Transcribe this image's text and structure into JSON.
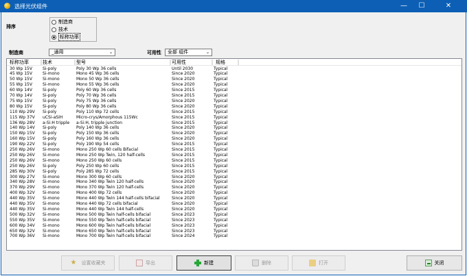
{
  "window": {
    "title": "选择光伏组件",
    "minimize": "—",
    "maximize": "☐",
    "close": "✕"
  },
  "sort": {
    "label": "排序",
    "options": [
      "制造商",
      "技术",
      "标称功率"
    ],
    "selected_index": 2
  },
  "filters": {
    "manufacturer_label": "制造商",
    "manufacturer_value": "_通用",
    "availability_label": "可用性",
    "availability_value": "全部 组件"
  },
  "table": {
    "columns": [
      "标称功率",
      "技术",
      "型号",
      "可用性",
      "规格"
    ],
    "rows": [
      [
        "30 Wp 15V",
        "Si-poly",
        "Poly 30 Wp 36 cells",
        "Until 2030",
        "Typical"
      ],
      [
        "45 Wp 15V",
        "Si-mono",
        "Mono 45 Wp 36 cells",
        "Since 2020",
        "Typical"
      ],
      [
        "50 Wp 15V",
        "Si-mono",
        "Mono 50 Wp 36 cells",
        "Since 2020",
        "Typical"
      ],
      [
        "55 Wp 15V",
        "Si-mono",
        "Mono 55 Wp 36 cells",
        "Since 2020",
        "Typical"
      ],
      [
        "60 Wp 14V",
        "Si-poly",
        "Poly 60 Wp  36 cells",
        "Since 2015",
        "Typical"
      ],
      [
        "70 Wp 14V",
        "Si-poly",
        "Poly 70 Wp 36 cells",
        "Since 2015",
        "Typical"
      ],
      [
        "75 Wp 15V",
        "Si-poly",
        "Poly 75 Wp 36 cells",
        "Since 2020",
        "Typical"
      ],
      [
        "80 Wp 15V",
        "Si-poly",
        "Poly 80 Wp 36 cells",
        "Since 2020",
        "Typical"
      ],
      [
        "110 Wp 29V",
        "Si-poly",
        "Poly 110 Wp  72 cells",
        "Since 2015",
        "Typical"
      ],
      [
        "115 Wp 37V",
        "uCSi-aSiH",
        "Micro-crys/Amorphous 115Wc",
        "Since 2015",
        "Typical"
      ],
      [
        "136 Wp 28V",
        "a-Si:H tripple",
        "a-Si:H, tripple junction",
        "Since 2015",
        "Typical"
      ],
      [
        "140 Wp 14V",
        "Si-poly",
        "Poly 140 Wp 36 cells",
        "Since 2020",
        "Typical"
      ],
      [
        "150 Wp 15V",
        "Si-poly",
        "Poly 150 Wp 36 cells",
        "Since 2020",
        "Typical"
      ],
      [
        "160 Wp 15V",
        "Si-poly",
        "Poly 160 Wp 36 cells",
        "Since 2020",
        "Typical"
      ],
      [
        "190 Wp 22V",
        "Si-poly",
        "Poly 190 Wp  54 cells",
        "Since 2015",
        "Typical"
      ],
      [
        "250 Wp 26V",
        "Si-mono",
        "Mono 250 Wp  60 cells Bifacial",
        "Since 2015",
        "Typical"
      ],
      [
        "250 Wp 26V",
        "Si-mono",
        "Mono 250 Wp  Twin, 120 half-cells",
        "Since 2015",
        "Typical"
      ],
      [
        "250 Wp 26V",
        "Si-mono",
        "Mono 250 Wp  60 cells",
        "Since 2015",
        "Typical"
      ],
      [
        "250 Wp 26V",
        "Si-poly",
        "Poly 250 Wp  60 cells",
        "Since 2015",
        "Typical"
      ],
      [
        "285 Wp 30V",
        "Si-poly",
        "Poly 285 Wp  72 cells",
        "Since 2015",
        "Typical"
      ],
      [
        "300 Wp 27V",
        "Si-mono",
        "Mono 300 Wp 60 cells",
        "Since 2020",
        "Typical"
      ],
      [
        "340 Wp 28V",
        "Si-mono",
        "Mono 340 Wp Twin 120 half-cells",
        "Since 2020",
        "Typical"
      ],
      [
        "370 Wp 29V",
        "Si-mono",
        "Mono 370 Wp Twin 120 half-cells",
        "Since 2020",
        "Typical"
      ],
      [
        "400 Wp 32V",
        "Si-mono",
        "Mono 400 Wp 72 cells",
        "Since 2020",
        "Typical"
      ],
      [
        "440 Wp 35V",
        "Si-mono",
        "Mono 440 Wp Twin 144 half-cells bifacial",
        "Since 2020",
        "Typical"
      ],
      [
        "440 Wp 35V",
        "Si-mono",
        "Mono 440 Wp 72 cells bifacial",
        "Since 2020",
        "Typical"
      ],
      [
        "440 Wp 35V",
        "Si-mono",
        "Mono 440 Wp Twin 144 half-cells",
        "Since 2020",
        "Typical"
      ],
      [
        "500 Wp 32V",
        "Si-mono",
        "Mono 500 Wp Twin half-cells bifacial",
        "Since 2023",
        "Typical"
      ],
      [
        "550 Wp 35V",
        "Si-mono",
        "Mono 550 Wp Twin half-cells bifacial",
        "Since 2023",
        "Typical"
      ],
      [
        "600 Wp 34V",
        "Si-mono",
        "Mono 600 Wp Twin half-cells bifacial",
        "Since 2023",
        "Typical"
      ],
      [
        "650 Wp 32V",
        "Si-mono",
        "Mono 650 Wp Twin half-cells bifacial",
        "Since 2023",
        "Typical"
      ],
      [
        "700 Wp 36V",
        "Si-mono",
        "Mono 700 Wp Twin half-cells bifacial",
        "Since 2024",
        "Typical"
      ]
    ]
  },
  "buttons": {
    "favorite": "设置收藏夹",
    "export": "导出",
    "new": "新建",
    "delete": "删除",
    "open": "打开",
    "close": "关闭"
  }
}
